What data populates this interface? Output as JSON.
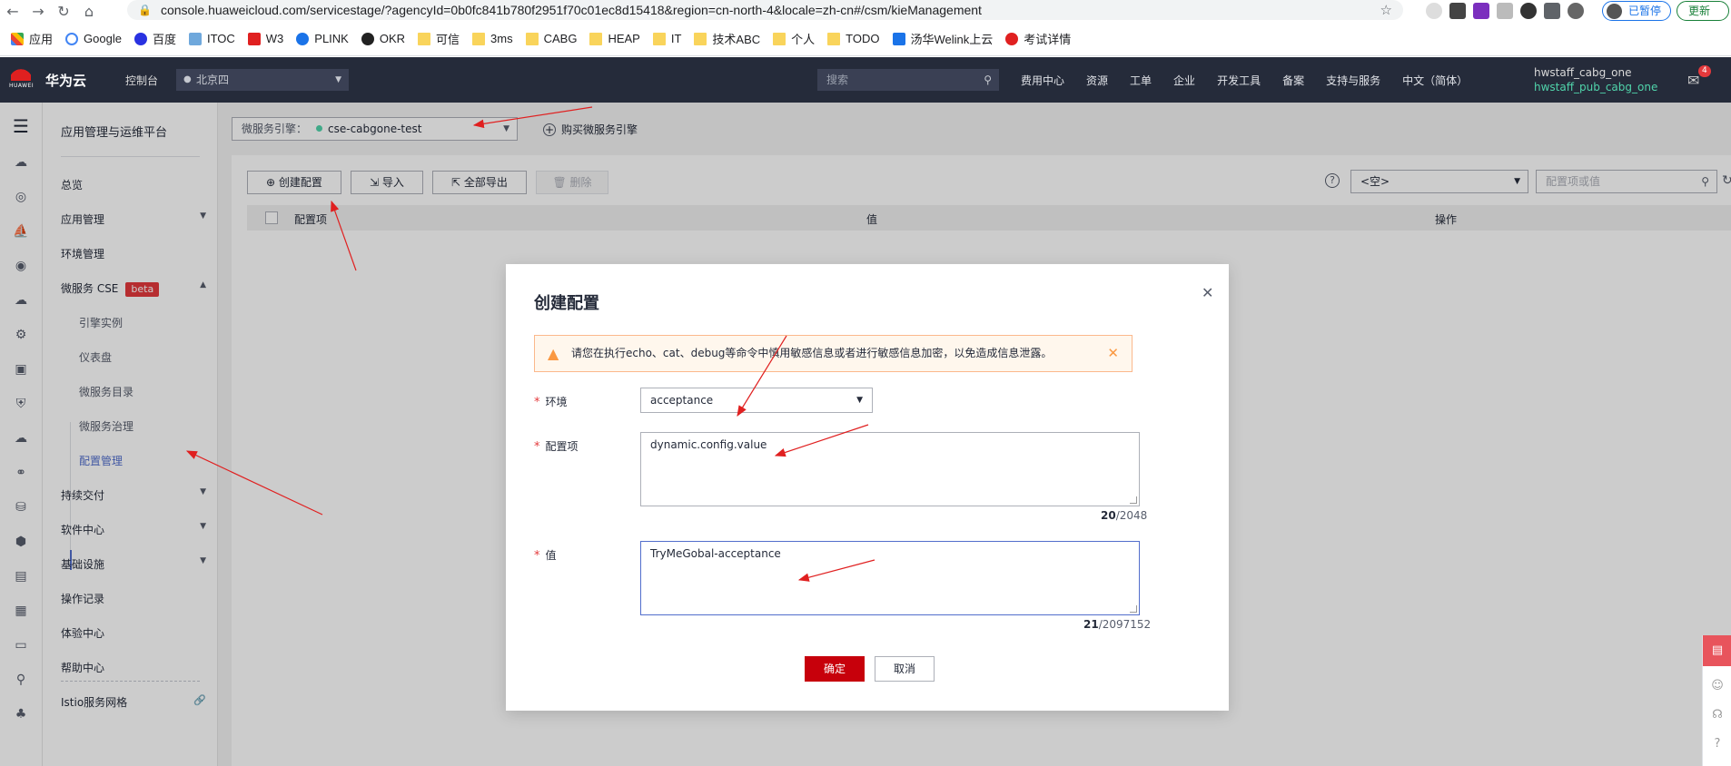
{
  "browser": {
    "url": "console.huaweicloud.com/servicestage/?agencyId=0b0fc841b780f2951f70c01ec8d15418&region=cn-north-4&locale=zh-cn#/csm/kieManagement",
    "paused_label": "已暂停",
    "update_label": "更新",
    "bookmarks": [
      "应用",
      "Google",
      "百度",
      "ITOC",
      "W3",
      "PLINK",
      "OKR",
      "可信",
      "3ms",
      "CABG",
      "HEAP",
      "IT",
      "技术ABC",
      "个人",
      "TODO",
      "汤华Welink上云",
      "考试详情"
    ]
  },
  "header": {
    "logo_text": "HUAWEI",
    "brand": "华为云",
    "console": "控制台",
    "region": "北京四",
    "search_placeholder": "搜索",
    "nav": [
      "费用中心",
      "资源",
      "工单",
      "企业",
      "开发工具",
      "备案",
      "支持与服务",
      "中文（简体）"
    ],
    "user_line1": "hwstaff_cabg_one",
    "user_line2": "hwstaff_pub_cabg_one",
    "mail_badge": "4"
  },
  "sidebar": {
    "title": "应用管理与运维平台",
    "items": {
      "overview": "总览",
      "app_mgmt": "应用管理",
      "env_mgmt": "环境管理",
      "cse": "微服务 CSE",
      "beta": "beta",
      "engine_instance": "引擎实例",
      "dashboard": "仪表盘",
      "catalog": "微服务目录",
      "governance": "微服务治理",
      "config_mgmt": "配置管理",
      "cd": "持续交付",
      "software": "软件中心",
      "infra": "基础设施",
      "oplog": "操作记录",
      "experience": "体验中心",
      "help": "帮助中心",
      "istio": "Istio服务网格"
    }
  },
  "main": {
    "engine_label": "微服务引擎：",
    "engine_value": "cse-cabgone-test",
    "buy_engine": "购买微服务引擎",
    "toolbar": {
      "create": "创建配置",
      "import": "导入",
      "export_all": "全部导出",
      "delete": "删除"
    },
    "filter_select": "<空>",
    "search_placeholder": "配置项或值",
    "columns": [
      "配置项",
      "值",
      "操作"
    ]
  },
  "modal": {
    "title": "创建配置",
    "warning": "请您在执行echo、cat、debug等命令中慎用敏感信息或者进行敏感信息加密，以免造成信息泄露。",
    "env_label": "环境",
    "env_value": "acceptance",
    "key_label": "配置项",
    "key_value": "dynamic.config.value",
    "key_count": "20",
    "key_max": "/2048",
    "value_label": "值",
    "value_value": "TryMeGobal-acceptance",
    "value_count": "21",
    "value_max": "/2097152",
    "ok": "确定",
    "cancel": "取消"
  },
  "colors": {
    "header_bg": "#252b3a",
    "brand_red": "#c7000b",
    "annotation_arrow": "#e02020",
    "warn_bg": "#fff7ed",
    "accent_blue": "#526ecc"
  }
}
